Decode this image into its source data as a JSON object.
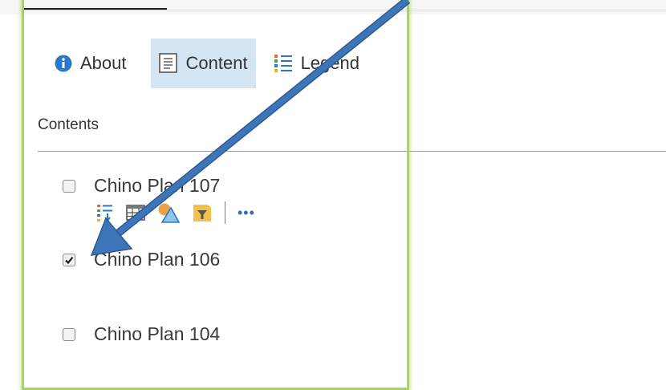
{
  "tabs": [
    {
      "label": "About",
      "icon": "info-icon",
      "active": false
    },
    {
      "label": "Content",
      "icon": "content-icon",
      "active": true
    },
    {
      "label": "Legend",
      "icon": "legend-icon",
      "active": false
    }
  ],
  "panel": {
    "title": "Contents"
  },
  "layers": [
    {
      "name": "Chino Plan 107",
      "checked": false
    },
    {
      "name": "Chino Plan 106",
      "checked": true
    },
    {
      "name": "Chino Plan 104",
      "checked": false
    }
  ],
  "layer_tools": {
    "icons": [
      "legend-toggle-icon",
      "attribute-table-icon",
      "change-style-icon",
      "filter-icon"
    ],
    "more_label": "•••"
  },
  "colors": {
    "accent": "#2a78c5",
    "active_tab": "#d4e6f4",
    "highlight": "#a6d65b",
    "arrow": "#3e75b8"
  }
}
